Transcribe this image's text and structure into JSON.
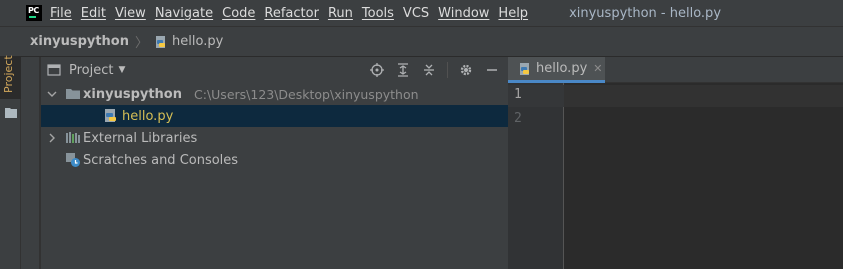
{
  "app": {
    "logo_icon": "pycharm-logo-icon",
    "logo_text": "PC",
    "window_title": "xinyuspython - hello.py"
  },
  "menu": {
    "items": [
      "File",
      "Edit",
      "View",
      "Navigate",
      "Code",
      "Refactor",
      "Run",
      "Tools",
      "VCS",
      "Window",
      "Help"
    ]
  },
  "breadcrumb": {
    "root": "xinyuspython",
    "file": "hello.py",
    "file_icon": "python-file-icon"
  },
  "tool_stripe": {
    "project_label": "Project",
    "folder_icon": "folder-icon"
  },
  "project_panel": {
    "title": "Project",
    "tools": [
      "locate-icon",
      "expand-all-icon",
      "collapse-all-icon",
      "gear-icon",
      "minimize-icon"
    ],
    "tree": {
      "root_name": "xinyuspython",
      "root_path": "C:\\Users\\123\\Desktop\\xinyuspython",
      "file_name": "hello.py",
      "external_libraries": "External Libraries",
      "scratches": "Scratches and Consoles"
    }
  },
  "editor": {
    "tab_label": "hello.py",
    "tab_close": "✕",
    "line_numbers": [
      "1",
      "2"
    ],
    "current_line": 1
  },
  "colors": {
    "menubar_bg": "#3c3f41",
    "editor_bg": "#2b2b2b",
    "selection": "#0d293e",
    "tab_underline": "#4a88c7",
    "python_file_text": "#d6bf55"
  }
}
